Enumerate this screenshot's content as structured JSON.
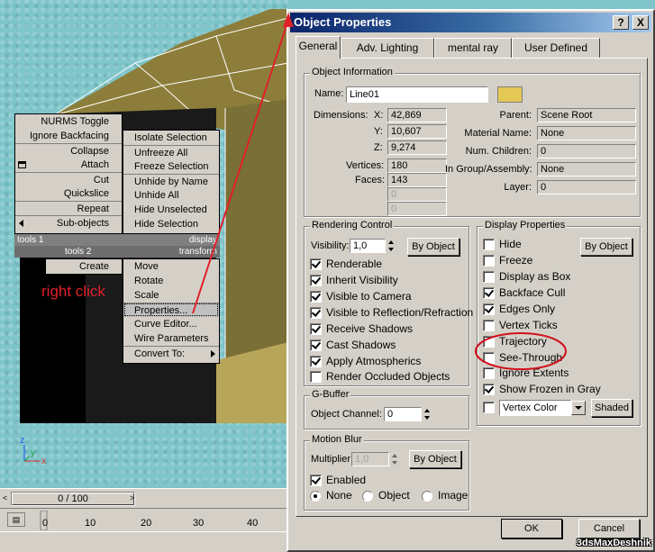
{
  "viewport": {
    "axis_z": "z",
    "axis_x": "x",
    "axis_y": "y"
  },
  "timeline": {
    "slider_value": "0 / 100",
    "arrow_left": "<",
    "arrow_right": ">",
    "ruler_ticks": [
      "0",
      "10",
      "20",
      "30",
      "40"
    ]
  },
  "quad_menu": {
    "left_top": [
      {
        "label": "NURMS Toggle"
      },
      {
        "label": "Ignore Backfacing"
      },
      {
        "label": "Collapse"
      },
      {
        "label": "Attach"
      },
      {
        "label": "Cut"
      },
      {
        "label": "Quickslice"
      },
      {
        "label": "Repeat"
      },
      {
        "label": "Sub-objects"
      }
    ],
    "headers": {
      "tools1": "tools 1",
      "display": "display",
      "tools2": "tools 2",
      "transform": "transform"
    },
    "left_bottom": [
      {
        "label": "Create"
      }
    ],
    "right_top": [
      {
        "label": "Isolate Selection"
      },
      {
        "label": "Unfreeze All"
      },
      {
        "label": "Freeze Selection"
      },
      {
        "label": "Unhide by Name"
      },
      {
        "label": "Unhide All"
      },
      {
        "label": "Hide Unselected"
      },
      {
        "label": "Hide Selection"
      }
    ],
    "right_bottom": [
      {
        "label": "Move"
      },
      {
        "label": "Rotate"
      },
      {
        "label": "Scale"
      },
      {
        "label": "Properties..."
      },
      {
        "label": "Curve Editor..."
      },
      {
        "label": "Wire Parameters"
      },
      {
        "label": "Convert To:"
      }
    ]
  },
  "annotation": {
    "text": "right click",
    "color": "#e0202a"
  },
  "dialog": {
    "title": "Object Properties",
    "help_btn": "?",
    "close_btn": "X",
    "tabs": [
      "General",
      "Adv. Lighting",
      "mental ray",
      "User Defined"
    ],
    "active_tab": "General",
    "object_info": {
      "title": "Object Information",
      "name_label": "Name:",
      "name_value": "Line01",
      "swatch_color": "#e3c856",
      "dimensions_label": "Dimensions:",
      "x_label": "X:",
      "x_value": "42,869",
      "y_label": "Y:",
      "y_value": "10,607",
      "z_label": "Z:",
      "z_value": "9,274",
      "vertices_label": "Vertices:",
      "vertices_value": "180",
      "faces_label": "Faces:",
      "faces_value": "143",
      "blank1": "0",
      "blank2": "0",
      "parent_label": "Parent:",
      "parent_value": "Scene Root",
      "material_label": "Material Name:",
      "material_value": "None",
      "children_label": "Num. Children:",
      "children_value": "0",
      "group_label": "In Group/Assembly:",
      "group_value": "None",
      "layer_label": "Layer:",
      "layer_value": "0"
    },
    "rendering": {
      "title": "Rendering Control",
      "visibility_label": "Visibility:",
      "visibility_value": "1,0",
      "by_object": "By Object",
      "items": [
        {
          "label": "Renderable",
          "checked": true
        },
        {
          "label": "Inherit Visibility",
          "checked": true
        },
        {
          "label": "Visible to Camera",
          "checked": true
        },
        {
          "label": "Visible to Reflection/Refraction",
          "checked": true
        },
        {
          "label": "Receive Shadows",
          "checked": true
        },
        {
          "label": "Cast Shadows",
          "checked": true
        },
        {
          "label": "Apply Atmospherics",
          "checked": true
        },
        {
          "label": "Render Occluded Objects",
          "checked": false
        }
      ]
    },
    "gbuffer": {
      "title": "G-Buffer",
      "channel_label": "Object Channel:",
      "channel_value": "0"
    },
    "motion_blur": {
      "title": "Motion Blur",
      "multiplier_label": "Multiplier:",
      "multiplier_value": "1,0",
      "by_object": "By Object",
      "enabled_label": "Enabled",
      "enabled_checked": true,
      "radios": [
        {
          "label": "None",
          "selected": true
        },
        {
          "label": "Object",
          "selected": false
        },
        {
          "label": "Image",
          "selected": false
        }
      ]
    },
    "display": {
      "title": "Display Properties",
      "by_object": "By Object",
      "items": [
        {
          "label": "Hide",
          "checked": false
        },
        {
          "label": "Freeze",
          "checked": false
        },
        {
          "label": "Display as Box",
          "checked": false
        },
        {
          "label": "Backface Cull",
          "checked": true
        },
        {
          "label": "Edges Only",
          "checked": true
        },
        {
          "label": "Vertex Ticks",
          "checked": false
        },
        {
          "label": "Trajectory",
          "checked": false
        },
        {
          "label": "See-Through",
          "checked": false
        },
        {
          "label": "Ignore Extents",
          "checked": false
        },
        {
          "label": "Show Frozen in Gray",
          "checked": true
        }
      ],
      "vertex_color_checked": false,
      "vertex_color_value": "Vertex Color",
      "shaded_btn": "Shaded"
    },
    "ok": "OK",
    "cancel": "Cancel"
  },
  "watermark": "3dsMaxDeshnik"
}
